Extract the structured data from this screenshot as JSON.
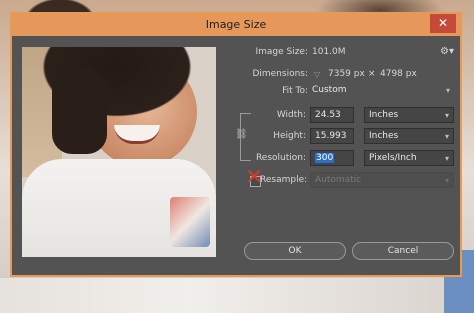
{
  "dialog": {
    "title": "Image Size",
    "close_glyph": "✕"
  },
  "info": {
    "image_size_label": "Image Size:",
    "image_size_value": "101.0M",
    "dimensions_label": "Dimensions:",
    "dimensions_width": "7359 px",
    "dimensions_times": "×",
    "dimensions_height": "4798 px",
    "fit_to_label": "Fit To:",
    "fit_to_value": "Custom"
  },
  "fields": {
    "width_label": "Width:",
    "width_value": "24.53",
    "width_unit": "Inches",
    "height_label": "Height:",
    "height_value": "15.993",
    "height_unit": "Inches",
    "resolution_label": "Resolution:",
    "resolution_value": "300",
    "resolution_unit": "Pixels/Inch",
    "resample_label": "Resample:",
    "resample_value": "Automatic"
  },
  "buttons": {
    "ok": "OK",
    "cancel": "Cancel"
  },
  "icons": {
    "gear": "gear-icon",
    "chain": "chain-link-icon",
    "chevron": "chevron-down-icon",
    "close": "close-icon"
  },
  "colors": {
    "titlebar": "#e6985b",
    "close": "#c64a3a",
    "dialog_bg": "#535353",
    "selection": "#2c6fc9"
  }
}
